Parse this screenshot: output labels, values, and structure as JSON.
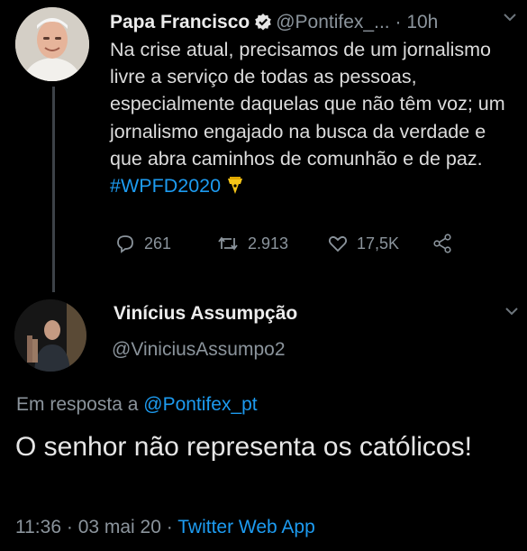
{
  "tweet1": {
    "name": "Papa Francisco",
    "handle": "@Pontifex_...",
    "separator": "·",
    "time": "10h",
    "text": "Na crise atual, precisamos de um jornalismo livre a serviço de todas as pessoas, especialmente daquelas que não têm voz; um jornalismo engajado na busca da verdade e que abra caminhos de comunhão e de paz. ",
    "hashtag": "#WPFD2020",
    "hashtag_icon": "pen-emoji-icon",
    "replies": "261",
    "retweets": "2.913",
    "likes": "17,5K"
  },
  "tweet2": {
    "name": "Vinícius Assumpção",
    "handle": "@ViniciusAssumpo2",
    "reply_prefix": "Em resposta a",
    "reply_handle": "@Pontifex_pt",
    "text": "O senhor não representa os católicos!",
    "time": "11:36",
    "date": "03 mai 20",
    "separator": "·",
    "source": "Twitter Web App"
  },
  "colors": {
    "background": "#000000",
    "link": "#1d9bf0",
    "muted": "#8b949c",
    "thread_line": "#3d4248"
  }
}
